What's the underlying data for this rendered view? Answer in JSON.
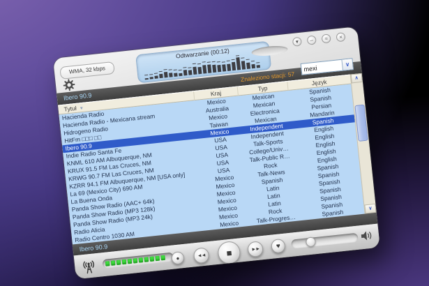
{
  "colors": {
    "selection": "#2f5bc9",
    "list_bg": "#b9d8f6",
    "header_bg": "#f1edde",
    "np_text": "#a9d6f5",
    "found_text": "#e59a2e",
    "green_segment": "#3fdd3f",
    "display_bg": "#bcd9f3",
    "dark_bar": "#474747"
  },
  "icons": {
    "menu": "▾",
    "minimize": "–",
    "compact": "≈",
    "close": "×",
    "dropdown": "∨",
    "scroll_up": "∧",
    "scroll_down": "∨",
    "sort": "▼",
    "record": "●",
    "previous": "◄◄",
    "stop": "■",
    "next": "►►",
    "heart": "♥"
  },
  "window": {
    "stream_info": "WMA, 32 kbps",
    "display": {
      "status": "Odtwarzanie (00:12)",
      "spectrum": {
        "bars": [
          0.12,
          0.14,
          0.18,
          0.28,
          0.38,
          0.32,
          0.26,
          0.22,
          0.38,
          0.34,
          0.55,
          0.5,
          0.62,
          0.58,
          0.56,
          0.52,
          0.48,
          0.52,
          0.58,
          0.9,
          0.62,
          0.46,
          0.32,
          0.18
        ],
        "peaks": [
          0.3,
          0.32,
          0.36,
          0.46,
          0.56,
          0.5,
          0.44,
          0.4,
          0.56,
          0.52,
          0.73,
          0.68,
          0.8,
          0.76,
          0.74,
          0.7,
          0.66,
          0.7,
          0.76,
          1.0,
          0.8,
          0.64,
          0.5,
          0.36
        ]
      }
    },
    "search": {
      "value": "mexi"
    },
    "status_bar": {
      "now_playing": "Ibero 90.9",
      "stations_found": "Znaleziono stacji: 57"
    },
    "list": {
      "columns": [
        "Tytuł",
        "Kraj",
        "Typ",
        "Język"
      ],
      "selected_index": 4,
      "rows": [
        {
          "title": "Hacienda Radio",
          "country": "Mexico",
          "type": "Mexican",
          "language": "Spanish"
        },
        {
          "title": "Hacienda Radio - Mexicana stream",
          "country": "Australia",
          "type": "Mexican",
          "language": "Spanish"
        },
        {
          "title": "Hidrogeno Radio",
          "country": "Mexico",
          "type": "Electronica",
          "language": "Persian"
        },
        {
          "title": "HitFm □□□ □□",
          "country": "Taiwan",
          "type": "Mexican",
          "language": "Mandarin"
        },
        {
          "title": "Ibero 90.9",
          "country": "Mexico",
          "type": "Independent",
          "language": "Spanish"
        },
        {
          "title": "Indie Radio Santa Fe",
          "country": "USA",
          "type": "Independent",
          "language": "English"
        },
        {
          "title": "KNML 610 AM Albuquerque, NM",
          "country": "USA",
          "type": "Talk-Sports",
          "language": "English"
        },
        {
          "title": "KRUX 91.5 FM Las Cruces, NM",
          "country": "USA",
          "type": "College/Univ…",
          "language": "English"
        },
        {
          "title": "KRWG 90.7 FM Las Cruces, NM",
          "country": "USA",
          "type": "Talk-Public R…",
          "language": "English"
        },
        {
          "title": "KZRR 94.1 FM Albuquerque, NM [USA only]",
          "country": "USA",
          "type": "Rock",
          "language": "English"
        },
        {
          "title": "La 69 (Mexico City) 690 AM",
          "country": "Mexico",
          "type": "Talk-News",
          "language": "Spanish"
        },
        {
          "title": "La Buena Onda",
          "country": "Mexico",
          "type": "Spanish",
          "language": "Spanish"
        },
        {
          "title": "Panda Show Radio (AAC+ 64k)",
          "country": "Mexico",
          "type": "Latin",
          "language": "Spanish"
        },
        {
          "title": "Panda Show Radio (MP3 128k)",
          "country": "Mexico",
          "type": "Latin",
          "language": "Spanish"
        },
        {
          "title": "Panda Show Radio (MP3 24k)",
          "country": "Mexico",
          "type": "Latin",
          "language": "Spanish"
        },
        {
          "title": "Radio Alicia",
          "country": "Mexico",
          "type": "Rock",
          "language": "Spanish"
        },
        {
          "title": "Radio Centro 1030 AM",
          "country": "Mexico",
          "type": "Talk-Progres…",
          "language": "Spanish"
        }
      ]
    },
    "bottom_bar": {
      "now_playing": "Ibero 90.9"
    },
    "buffer": {
      "segments": 11
    },
    "volume": {
      "level": 0.22
    }
  }
}
